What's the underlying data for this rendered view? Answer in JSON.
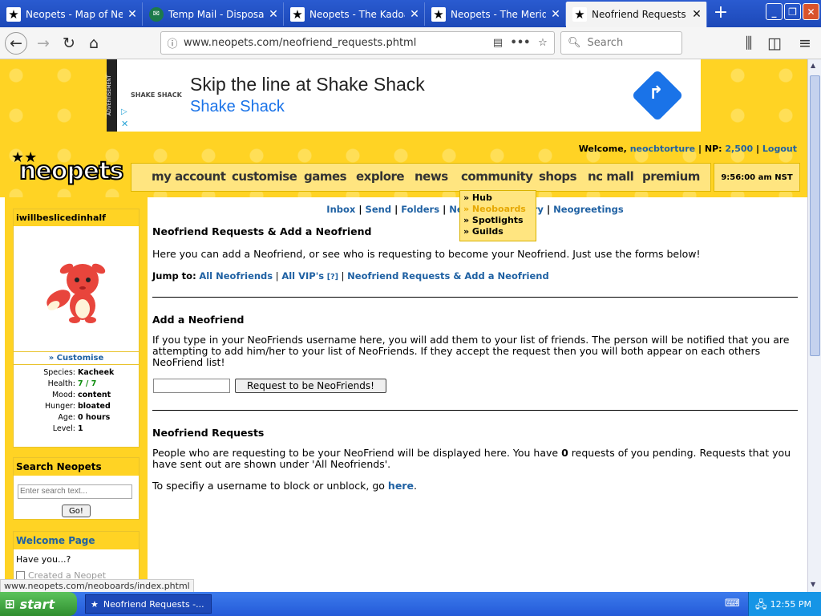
{
  "browser": {
    "tabs": [
      {
        "title": "Neopets - Map of Neopia",
        "icon": "neopets-star-icon"
      },
      {
        "title": "Temp Mail - Disposable Tem",
        "icon": "tempmail-icon"
      },
      {
        "title": "Neopets - The Kadoatery",
        "icon": "neopets-star-icon"
      },
      {
        "title": "Neopets - The Meridell Brig",
        "icon": "neopets-star-icon"
      },
      {
        "title": "Neofriend Requests",
        "icon": "neopets-star-icon"
      }
    ],
    "url": "www.neopets.com/neofriend_requests.phtml",
    "search_placeholder": "Search",
    "status_url": "www.neopets.com/neoboards/index.phtml"
  },
  "ad": {
    "label": "ADVERTISEMENT",
    "brand_small": "SHAKE SHACK",
    "headline": "Skip the line at Shake Shack",
    "subline": "Shake Shack"
  },
  "header": {
    "logo": "neopets",
    "welcome_prefix": "Welcome,",
    "username": "neocbtorture",
    "np_label": "NP:",
    "np_value": "2,500",
    "logout": "Logout",
    "clock": "9:56:00 am NST",
    "menu": [
      "my account",
      "customise",
      "games",
      "explore",
      "news",
      "community",
      "shops",
      "nc mall",
      "premium"
    ]
  },
  "dropdown": {
    "items": [
      "» Hub",
      "» Neoboards",
      "» Spotlights",
      "» Guilds"
    ]
  },
  "sidebar": {
    "pet_name": "iwillbeslicedinhalf",
    "customise": "» Customise",
    "stats": [
      {
        "label": "Species:",
        "value": "Kacheek"
      },
      {
        "label": "Health:",
        "value": "7 / 7"
      },
      {
        "label": "Mood:",
        "value": "content"
      },
      {
        "label": "Hunger:",
        "value": "bloated"
      },
      {
        "label": "Age:",
        "value": "0 hours"
      },
      {
        "label": "Level:",
        "value": "1"
      }
    ],
    "search_title": "Search Neopets",
    "search_placeholder": "Enter search text...",
    "search_button": "Go!",
    "welcome_title": "Welcome Page",
    "welcome_text": "Have you...?",
    "welcome_item": "Created a Neopet"
  },
  "subnav": {
    "items": [
      "Inbox",
      "Send",
      "Folders",
      "Neofriends",
      "Diary",
      "Neogreetings"
    ],
    "visible_partial": "Neofr"
  },
  "content": {
    "page_title": "Neofriend Requests & Add a Neofriend",
    "intro": "Here you can add a Neofriend, or see who is requesting to become your Neofriend. Just use the forms below!",
    "jump_label": "Jump to:",
    "jump_links": [
      "All Neofriends",
      "All VIP's",
      "[?]",
      "Neofriend Requests & Add a Neofriend"
    ],
    "add_title": "Add a Neofriend",
    "add_text": "If you type in your NeoFriends username here, you will add them to your list of friends. The person will be notified that you are attempting to add him/her to your list of NeoFriends. If they accept the request then you will both appear on each others NeoFriend list!",
    "add_button": "Request to be NeoFriends!",
    "requests_title": "Neofriend Requests",
    "requests_text_1": "People who are requesting to be your NeoFriend will be displayed here. You have",
    "requests_count": "0",
    "requests_text_2": "requests of you pending. Requests that you have sent out are shown under 'All Neofriends'.",
    "block_text": "To specifiy a username to block or unblock, go",
    "block_link": "here",
    "block_end": "."
  },
  "taskbar": {
    "start": "start",
    "task": "Neofriend Requests -...",
    "time": "12:55 PM"
  },
  "colors": {
    "neo_yellow": "#ffd324",
    "link_blue": "#1f61a3",
    "xp_blue": "#245ad8"
  }
}
